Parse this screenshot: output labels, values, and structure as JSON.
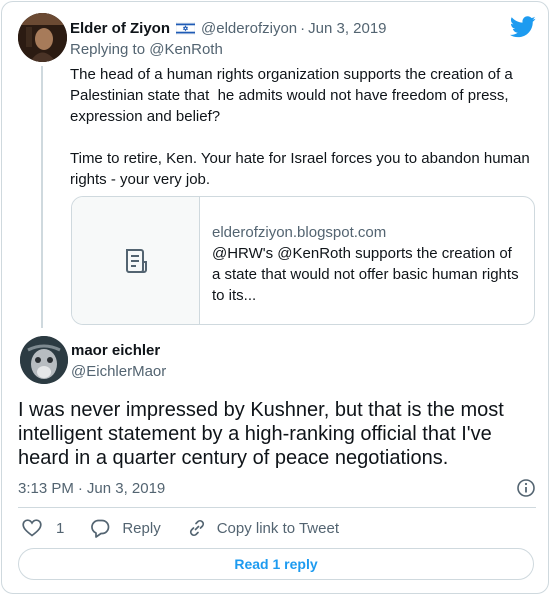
{
  "parent_tweet": {
    "name": "Elder of Ziyon",
    "handle": "@elderofziyon",
    "date": "Jun 3, 2019",
    "replying_prefix": "Replying to ",
    "replying_to": "@KenRoth",
    "text": "The head of a human rights organization supports the creation of a Palestinian state that  he admits would not have freedom of press, expression and belief?\n\nTime to retire, Ken. Your hate for Israel forces you to abandon human rights - your very job.",
    "link_card": {
      "domain": "elderofziyon.blogspot.com",
      "description": "@HRW's @KenRoth supports the creation of a state that would not offer basic human rights to its..."
    }
  },
  "main_tweet": {
    "name": "maor eichler",
    "handle": "@EichlerMaor",
    "text": "I was never impressed by Kushner, but that is the most intelligent statement by a high-ranking official that I've heard in a quarter century of peace negotiations.",
    "time": "3:13 PM",
    "date": "Jun 3, 2019",
    "like_count": "1",
    "reply_label": "Reply",
    "copy_link_label": "Copy link to Tweet",
    "read_reply_label": "Read 1 reply"
  },
  "colors": {
    "accent": "#1d9bf0",
    "secondary_text": "#536471",
    "border": "#cfd9de"
  },
  "icons": [
    "israel-flag-icon",
    "twitter-bird-icon",
    "document-icon",
    "info-icon",
    "heart-icon",
    "reply-bubble-icon",
    "link-icon"
  ]
}
